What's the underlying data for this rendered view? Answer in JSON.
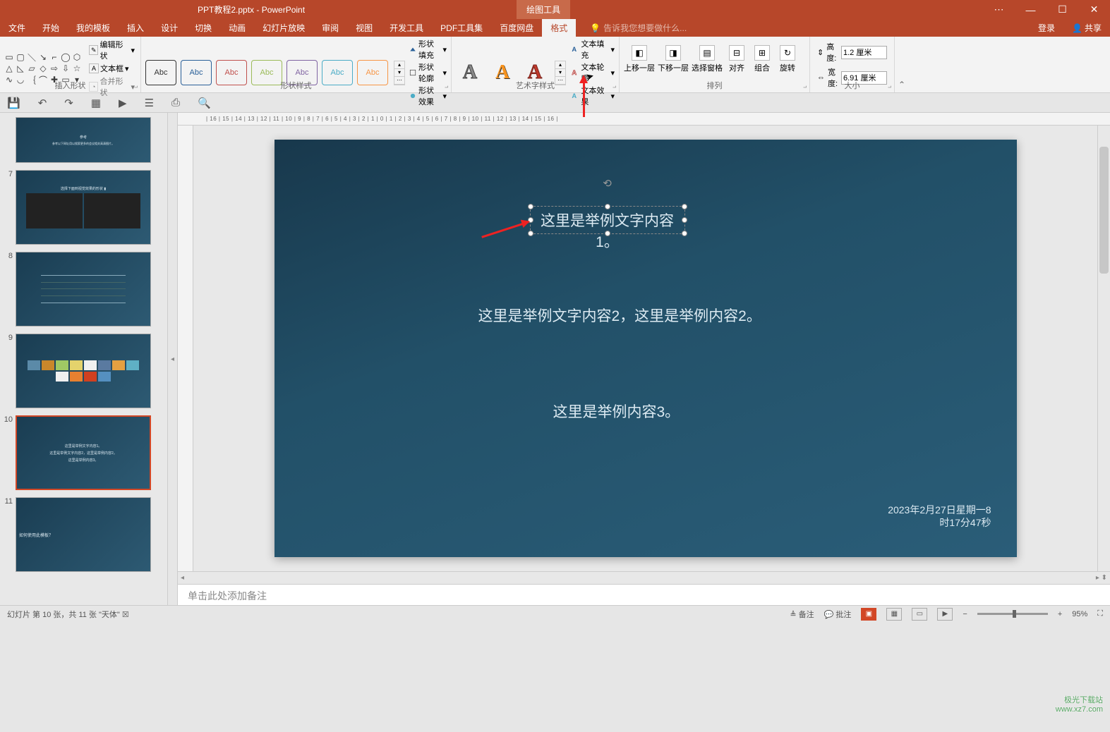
{
  "title": {
    "doc": "PPT教程2.pptx - PowerPoint",
    "context": "绘图工具"
  },
  "win": {
    "opts": "⋯",
    "min": "—",
    "max": "☐",
    "close": "✕"
  },
  "menu": {
    "file": "文件",
    "home": "开始",
    "template": "我的模板",
    "insert": "插入",
    "design": "设计",
    "transition": "切换",
    "animation": "动画",
    "slideshow": "幻灯片放映",
    "review": "审阅",
    "view": "视图",
    "dev": "开发工具",
    "pdf": "PDF工具集",
    "baidu": "百度网盘",
    "format": "格式",
    "tellme": "告诉我您想要做什么...",
    "login": "登录",
    "share": "共享"
  },
  "ribbon": {
    "shapes": {
      "title": "插入形状",
      "edit": "编辑形状",
      "textbox": "文本框",
      "merge": "合并形状"
    },
    "styles": {
      "title": "形状样式",
      "abc": "Abc",
      "fill": "形状填充",
      "outline": "形状轮廓",
      "effects": "形状效果"
    },
    "wordart": {
      "title": "艺术字样式",
      "a": "A",
      "textfill": "文本填充",
      "textoutline": "文本轮廓",
      "texteffects": "文本效果"
    },
    "arrange": {
      "title": "排列",
      "front": "上移一层",
      "back": "下移一层",
      "pane": "选择窗格",
      "align": "对齐",
      "group": "组合",
      "rotate": "旋转"
    },
    "size": {
      "title": "大小",
      "height_label": "高度:",
      "height_val": "1.2 厘米",
      "width_label": "宽度:",
      "width_val": "6.91 厘米"
    }
  },
  "ruler": "| 16 | 15 | 14 | 13 | 12 | 11 | 10 | 9 | 8 | 7 | 6 | 5 | 4 | 3 | 2 | 1 | 0 | 1 | 2 | 3 | 4 | 5 | 6 | 7 | 8 | 9 | 10 | 11 | 12 | 13 | 14 | 15 | 16 |",
  "thumbs": {
    "n7": "7",
    "n8": "8",
    "n9": "9",
    "n10": "10",
    "n11": "11"
  },
  "slide": {
    "tb1": "这里是举例文字内容1。",
    "tb2": "这里是举例文字内容2，这里是举例内容2。",
    "tb3": "这里是举例内容3。",
    "date1": "2023年2月27日星期一8",
    "date2": "时17分47秒"
  },
  "notes": "单击此处添加备注",
  "status": {
    "left": "幻灯片 第 10 张，共 11 张    \"天体\"    ☒",
    "notes": "备注",
    "comments": "批注",
    "zoom": "95%",
    "fit": "⛶",
    "minus": "−",
    "plus": "+"
  },
  "watermark": {
    "l1": "极光下载站",
    "l2": "www.xz7.com"
  }
}
